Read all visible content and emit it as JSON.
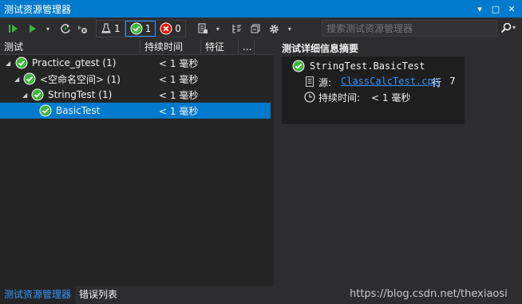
{
  "window": {
    "title": "测试资源管理器",
    "controls": {
      "dropdown": "▾",
      "maximize": "□",
      "close": "✕"
    }
  },
  "toolbar": {
    "filters": [
      {
        "icon": "flask-icon",
        "count": "1"
      },
      {
        "icon": "passed-icon",
        "count": "1"
      },
      {
        "icon": "failed-icon",
        "count": "0"
      }
    ],
    "search_placeholder": "搜索测试资源管理器"
  },
  "tree": {
    "columns": [
      "测试",
      "持续时间",
      "特征",
      "..."
    ],
    "rows": [
      {
        "label": "Practice_gtest (1)",
        "duration": "< 1 毫秒",
        "expander": "◢",
        "level": 0
      },
      {
        "label": "<空命名空间> (1)",
        "duration": "< 1 毫秒",
        "expander": "◢",
        "level": 1
      },
      {
        "label": "StringTest (1)",
        "duration": "< 1 毫秒",
        "expander": "◢",
        "level": 2
      },
      {
        "label": "BasicTest",
        "duration": "< 1 毫秒",
        "expander": "",
        "level": 3,
        "selected": true
      }
    ]
  },
  "details": {
    "title": "测试详细信息摘要",
    "test_name": "StringTest.BasicTest",
    "source_label": "源:",
    "source_file": "ClassCalcTest.cpp",
    "line_label": "行",
    "line_number": "7",
    "duration_label": "持续时间:",
    "duration_value": "< 1 毫秒"
  },
  "tabs": [
    {
      "label": "测试资源管理器",
      "active": true
    },
    {
      "label": "错误列表",
      "active": false
    }
  ],
  "watermark": "https://blog.csdn.net/thexiaosi",
  "colors": {
    "accent": "#007acc",
    "pass": "#3fb33f",
    "fail": "#e51400",
    "link": "#3794ff"
  }
}
